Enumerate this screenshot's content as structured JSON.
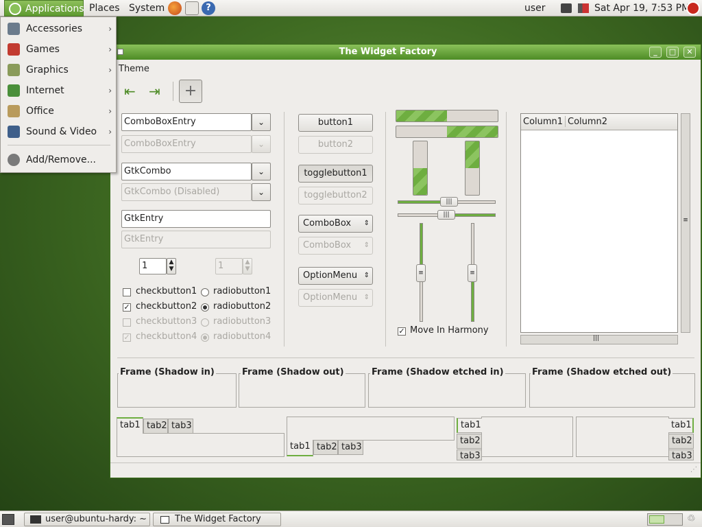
{
  "top_panel": {
    "menus": [
      "Applications",
      "Places",
      "System"
    ],
    "user": "user",
    "clock": "Sat Apr 19,  7:53 PM"
  },
  "app_menu": {
    "items": [
      {
        "label": "Accessories",
        "icon": "accessories-icon",
        "color": "#6b7b8c"
      },
      {
        "label": "Games",
        "icon": "games-icon",
        "color": "#c23b30"
      },
      {
        "label": "Graphics",
        "icon": "graphics-icon",
        "color": "#8a9b5a"
      },
      {
        "label": "Internet",
        "icon": "internet-icon",
        "color": "#4a8f3a"
      },
      {
        "label": "Office",
        "icon": "office-icon",
        "color": "#b99b5c"
      },
      {
        "label": "Sound & Video",
        "icon": "sound-video-icon",
        "color": "#3f5f8a"
      }
    ],
    "add_remove": "Add/Remove..."
  },
  "window": {
    "title": "The Widget Factory",
    "menu": "Theme"
  },
  "left": {
    "combo_entry": "ComboBoxEntry",
    "combo_entry_dis": "ComboBoxEntry",
    "gtk_combo": "GtkCombo",
    "gtk_combo_dis": "GtkCombo (Disabled)",
    "entry": "GtkEntry",
    "entry_dis": "GtkEntry",
    "spin1": "1",
    "spin2": "1",
    "check1": "checkbutton1",
    "check2": "checkbutton2",
    "check3": "checkbutton3",
    "check4": "checkbutton4",
    "radio1": "radiobutton1",
    "radio2": "radiobutton2",
    "radio3": "radiobutton3",
    "radio4": "radiobutton4"
  },
  "middle": {
    "button1": "button1",
    "button2": "button2",
    "toggle1": "togglebutton1",
    "toggle2": "togglebutton2",
    "combobox": "ComboBox",
    "combobox_dis": "ComboBox",
    "optionmenu": "OptionMenu",
    "optionmenu_dis": "OptionMenu"
  },
  "sliders": {
    "progress_h1": 0.5,
    "progress_h2": 0.5,
    "progress_v1": 0.5,
    "progress_v2": 0.5,
    "harmony_label": "Move In Harmony"
  },
  "tree": {
    "col1": "Column1",
    "col2": "Column2"
  },
  "frames": [
    "Frame (Shadow in)",
    "Frame (Shadow out)",
    "Frame (Shadow etched in)",
    "Frame (Shadow etched out)"
  ],
  "tabs": [
    "tab1",
    "tab2",
    "tab3"
  ],
  "bottom_panel": {
    "task1": "user@ubuntu-hardy: ~",
    "task2": "The Widget Factory"
  }
}
